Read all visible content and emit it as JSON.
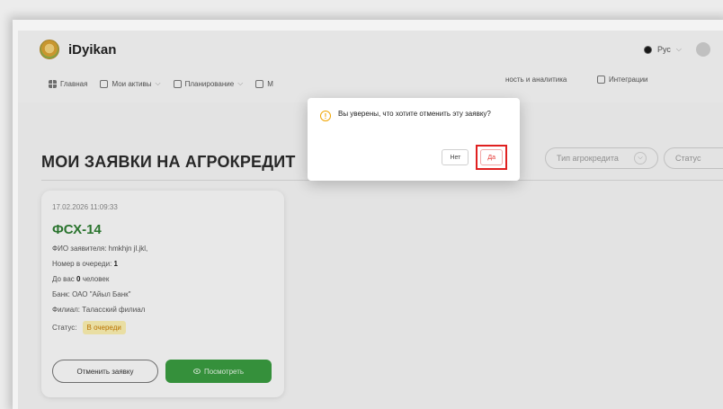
{
  "app": {
    "name": "iDyikan"
  },
  "header": {
    "language": "Рус"
  },
  "nav": {
    "home": "Главная",
    "assets": "Мои активы",
    "planning": "Планирование",
    "partial_m": "М",
    "analytics": "ность и аналитика",
    "integrations": "Интеграции"
  },
  "page": {
    "title": "МОИ ЗАЯВКИ НА АГРОКРЕДИТ",
    "filter_type_placeholder": "Тип агрокредита",
    "filter_status_placeholder": "Статус"
  },
  "card": {
    "date": "17.02.2026 11:09:33",
    "title": "ФСХ-14",
    "applicant": "ФИО заявителя: hmkhjn jl.jkl,",
    "queue_label": "Номер в очереди: ",
    "queue_value": "1",
    "ahead_prefix": "До вас ",
    "ahead_value": "0",
    "ahead_suffix": " человек",
    "bank": "Банк: ОАО \"Айыл Банк\"",
    "branch": "Филиал: Таласский филиал",
    "status_label": "Статус:",
    "status_value": "В очереди",
    "cancel_button": "Отменить заявку",
    "view_button": "Посмотреть"
  },
  "modal": {
    "message": "Вы уверены, что хотите отменить эту заявку?",
    "no_button": "Нет",
    "yes_button": "Да"
  },
  "colors": {
    "brand_green": "#3a9b40",
    "title_green": "#2e7d32",
    "status_badge_bg": "#fbefb0",
    "danger_red": "#e53935",
    "warning_orange": "#f0a500"
  }
}
